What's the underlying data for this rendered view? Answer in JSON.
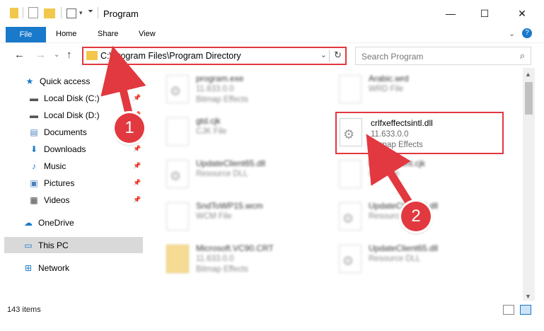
{
  "window": {
    "title": "Program",
    "minimize": "—",
    "maximize": "☐",
    "close": "✕"
  },
  "ribbon": {
    "file": "File",
    "home": "Home",
    "share": "Share",
    "view": "View",
    "expand": "⌄",
    "help": "?"
  },
  "address": {
    "path": "C:\\Program Files\\Program Directory",
    "dropdown": "⌄",
    "refresh": "↻"
  },
  "search": {
    "placeholder": "Search Program",
    "icon": "⌕"
  },
  "nav": {
    "back": "←",
    "forward": "→",
    "recent": "⌄",
    "up": "↑",
    "items": [
      {
        "label": "Quick access",
        "icon": "star-icon",
        "glyph": "★",
        "color": "#1979ca"
      },
      {
        "label": "Local Disk (C:)",
        "icon": "drive-icon",
        "glyph": "▬",
        "color": "#555555",
        "pinned": true
      },
      {
        "label": "Local Disk (D:)",
        "icon": "drive-icon",
        "glyph": "▬",
        "color": "#555555",
        "pinned": true
      },
      {
        "label": "Documents",
        "icon": "documents-icon",
        "glyph": "▤",
        "color": "#4a7fbf",
        "pinned": true
      },
      {
        "label": "Downloads",
        "icon": "download-icon",
        "glyph": "⬇",
        "color": "#1979ca",
        "pinned": true
      },
      {
        "label": "Music",
        "icon": "music-icon",
        "glyph": "♪",
        "color": "#1979ca",
        "pinned": true
      },
      {
        "label": "Pictures",
        "icon": "pictures-icon",
        "glyph": "▣",
        "color": "#4a7fbf",
        "pinned": true
      },
      {
        "label": "Videos",
        "icon": "videos-icon",
        "glyph": "▦",
        "color": "#444444",
        "pinned": true
      },
      {
        "label": "OneDrive",
        "icon": "cloud-icon",
        "glyph": "☁",
        "color": "#1979ca"
      },
      {
        "label": "This PC",
        "icon": "computer-icon",
        "glyph": "▭",
        "color": "#1979ca"
      },
      {
        "label": "Network",
        "icon": "network-icon",
        "glyph": "⊞",
        "color": "#1979ca"
      }
    ]
  },
  "files": [
    {
      "name": "program.exe",
      "line1": "11.633.0.0",
      "line2": "Bitmap Effects",
      "icon": "gear"
    },
    {
      "name": "Arabic.wrd",
      "line1": "WRD File",
      "line2": "",
      "icon": "doc"
    },
    {
      "name": "gtd.cjk",
      "line1": "CJK File",
      "line2": "",
      "icon": "doc"
    },
    {
      "name": "crlfxeffectsintl.dll",
      "line1": "11.633.0.0",
      "line2": "Bitmap Effects",
      "icon": "gear"
    },
    {
      "name": "UpdateClient65.dll",
      "line1": "Resource DLL",
      "line2": "",
      "icon": "gear"
    },
    {
      "name": "DefaultFont.cjk",
      "line1": "CJK File",
      "line2": "",
      "icon": "doc"
    },
    {
      "name": "SndToWP15.wcm",
      "line1": "WCM File",
      "line2": "",
      "icon": "doc"
    },
    {
      "name": "UpdateClient63.dll",
      "line1": "Resource DLL",
      "line2": "",
      "icon": "gear"
    },
    {
      "name": "Microsoft.VC90.CRT",
      "line1": "11.633.0.0",
      "line2": "Bitmap Effects",
      "icon": "folder"
    },
    {
      "name": "UpdateClient65.dll",
      "line1": "Resource DLL",
      "line2": "",
      "icon": "gear"
    }
  ],
  "status": {
    "count": "143 items"
  },
  "annotations": {
    "step1": "1",
    "step2": "2",
    "color": "#e2383f"
  }
}
